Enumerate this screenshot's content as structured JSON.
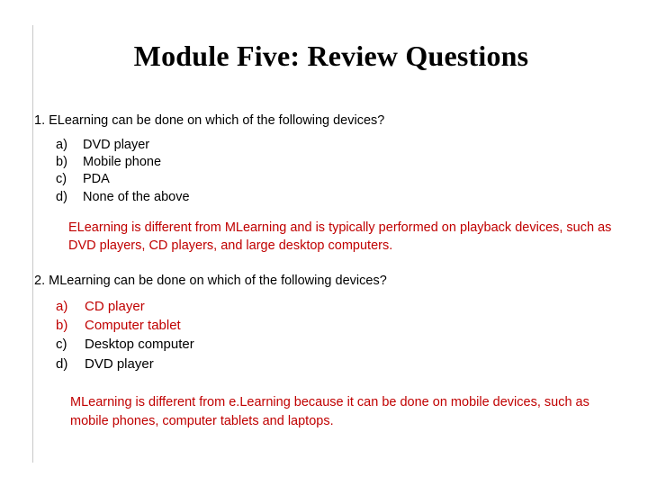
{
  "slide": {
    "title": "Module Five: Review Questions",
    "questions": [
      {
        "number": "1.",
        "text": "1. ELearning can be done on which of the following devices?",
        "choices": [
          {
            "marker": "a)",
            "label": "DVD player",
            "highlight": false
          },
          {
            "marker": "b)",
            "label": "Mobile phone",
            "highlight": false
          },
          {
            "marker": "c)",
            "label": "PDA",
            "highlight": false
          },
          {
            "marker": "d)",
            "label": "None of the above",
            "highlight": false
          }
        ],
        "answer": "ELearning is different from MLearning and is typically performed on playback devices, such as DVD players, CD players, and large desktop computers."
      },
      {
        "number": "2.",
        "text": "2. MLearning can be done on which of the following devices?",
        "choices": [
          {
            "marker": "a)",
            "label": "CD player",
            "highlight": true
          },
          {
            "marker": "b)",
            "label": "Computer tablet",
            "highlight": true
          },
          {
            "marker": "c)",
            "label": "Desktop computer",
            "highlight": false
          },
          {
            "marker": "d)",
            "label": "DVD player",
            "highlight": false
          }
        ],
        "answer": "MLearning is different from e.Learning because it can be done on mobile devices, such as mobile phones, computer tablets and laptops."
      }
    ],
    "colors": {
      "answer_text": "#c00000",
      "body_text": "#000000",
      "rule": "#c8c8c8"
    }
  }
}
